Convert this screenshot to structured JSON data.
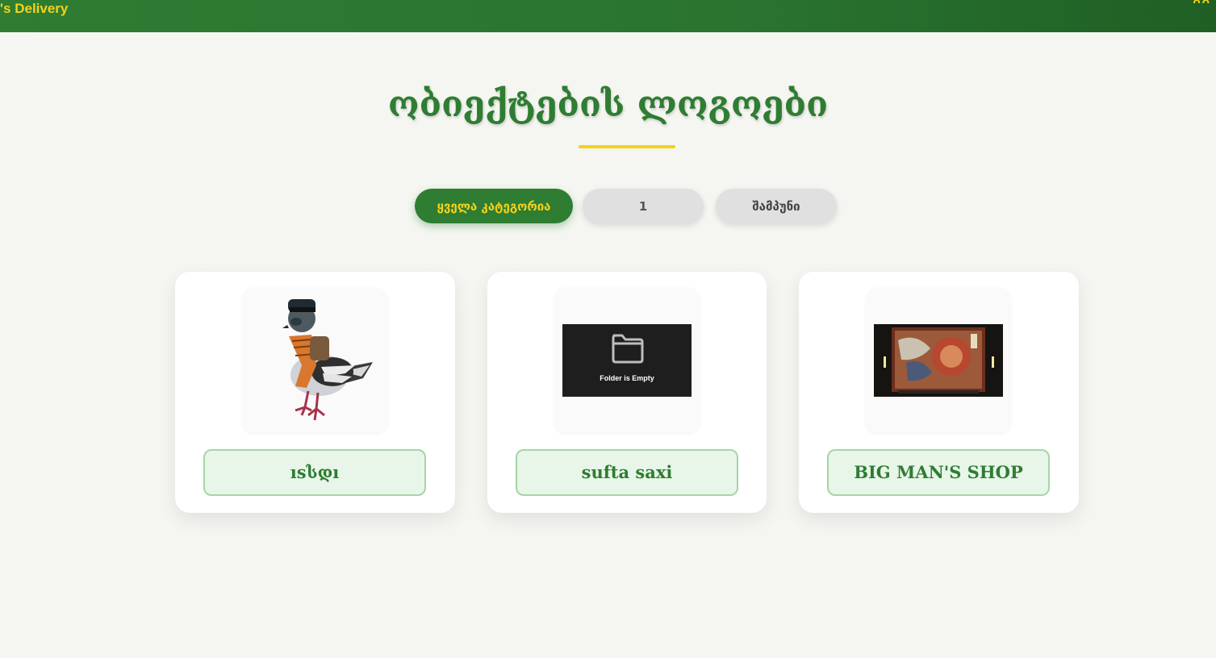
{
  "header": {
    "brand": "'s Delivery",
    "marks": "ᲒᲒ"
  },
  "page": {
    "title": "ობიექტების ლოგოები"
  },
  "filters": [
    {
      "label": "ყველა კატეგორია",
      "active": true
    },
    {
      "label": "1",
      "active": false
    },
    {
      "label": "შამპუნი",
      "active": false
    }
  ],
  "cards": [
    {
      "name": "ısსდı",
      "logo": "pigeon-logo"
    },
    {
      "name": "sufta saxi",
      "logo": "empty-folder-logo",
      "logo_text": "Folder is Empty"
    },
    {
      "name": "BIG MAN'S SHOP",
      "logo": "japanese-painting-logo"
    }
  ],
  "colors": {
    "primary": "#2e7d32",
    "accent": "#f6d11a",
    "background": "#f5f6f1",
    "card_name_bg": "#e8f5e9",
    "card_name_border": "#a5d6a7"
  }
}
